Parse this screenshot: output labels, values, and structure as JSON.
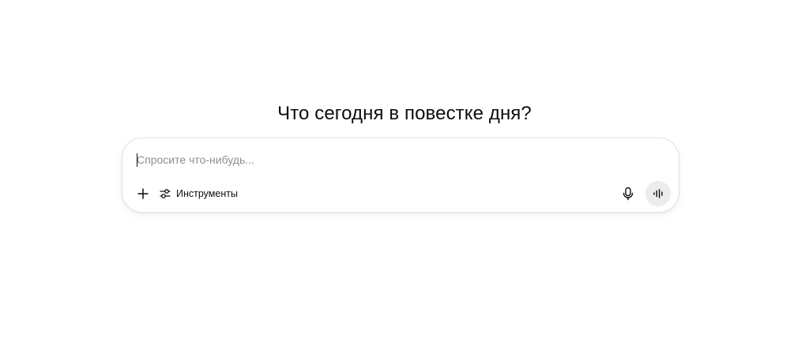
{
  "main": {
    "heading": "Что сегодня в повестке дня?"
  },
  "composer": {
    "placeholder": "Спросите что-нибудь...",
    "value": "",
    "tools_label": "Инструменты"
  },
  "icons": {
    "add": "plus-icon",
    "tools": "sliders-icon",
    "mic": "microphone-icon",
    "voice": "voice-waveform-icon"
  },
  "colors": {
    "text": "#0d0d0d",
    "placeholder": "#8f8f8f",
    "voice_button_bg": "#ececec",
    "border": "#e3e3e3"
  }
}
